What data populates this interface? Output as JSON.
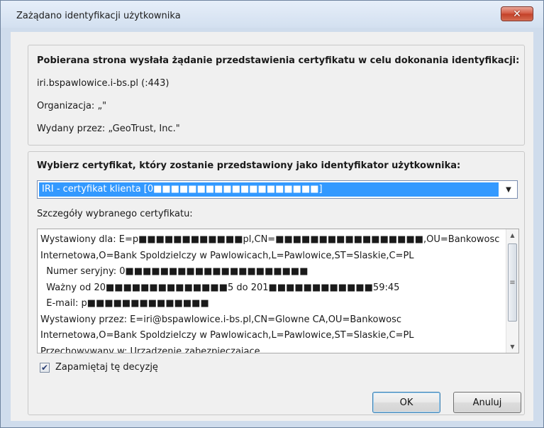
{
  "window": {
    "title": "Zażądano identyfikacji użytkownika",
    "close_glyph": "✕"
  },
  "request": {
    "heading": "Pobierana strona wysłała żądanie przedstawienia certyfikatu w celu dokonania identyfikacji:",
    "host": "iri.bspawlowice.i-bs.pl (:443)",
    "organization": "Organizacja: „\"",
    "issued_by": "Wydany przez: „GeoTrust, Inc.\""
  },
  "selection": {
    "heading": "Wybierz certyfikat, który zostanie przedstawiony jako identyfikator użytkownika:",
    "selected_certificate": "IRI - certyfikat klienta [0■■■■■■■■■■■■■■■■■■■]",
    "details_label": "Szczegóły wybranego certyfikatu:",
    "details_lines": [
      "Wystawiony dla: E=p■■■■■■■■■■■■pl,CN=■■■■■■■■■■■■■■■■■,OU=Bankowosc",
      "Internetowa,O=Bank Spoldzielczy w Pawlowicach,L=Pawlowice,ST=Slaskie,C=PL",
      "  Numer seryjny: 0■■■■■■■■■■■■■■■■■■■■■",
      "  Ważny od 20■■■■■■■■■■■■■■5 do 201■■■■■■■■■■■■59:45",
      "  E-mail: p■■■■■■■■■■■■■■",
      "Wystawiony przez: E=iri@bspawlowice.i-bs.pl,CN=Glowne CA,OU=Bankowosc",
      "Internetowa,O=Bank Spoldzielczy w Pawlowicach,L=Pawlowice,ST=Slaskie,C=PL",
      "Przechowywany w: Urządzenie zabezpieczające"
    ],
    "remember_label": "Zapamiętaj tę decyzję",
    "remember_checked": true
  },
  "buttons": {
    "ok": "OK",
    "cancel": "Anuluj"
  }
}
